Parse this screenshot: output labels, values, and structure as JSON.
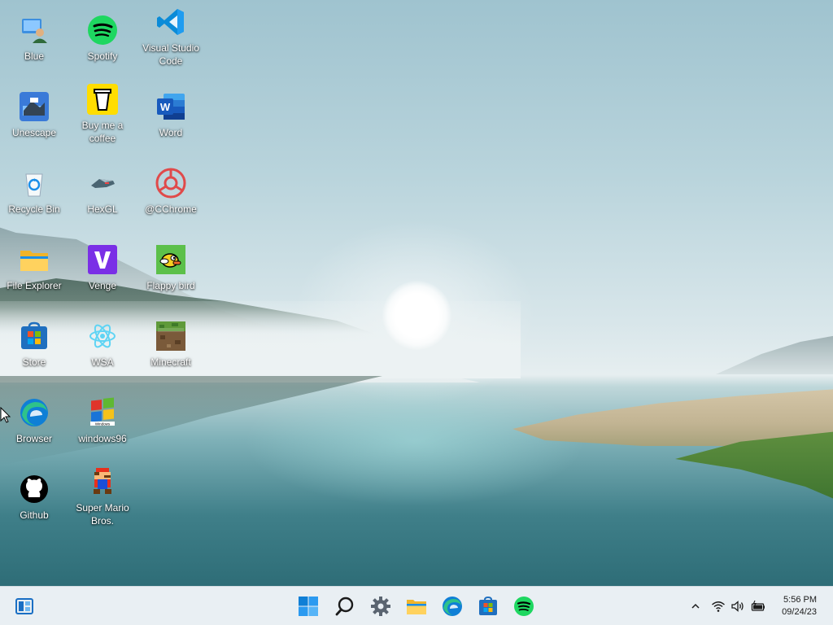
{
  "desktop_icons": [
    {
      "label": "Blue",
      "icon": "blue-user-icon"
    },
    {
      "label": "Spotify",
      "icon": "spotify-icon"
    },
    {
      "label": "Visual Studio Code",
      "icon": "vscode-icon"
    },
    {
      "label": "Unescape",
      "icon": "unescape-game-icon"
    },
    {
      "label": "Buy me a coffee",
      "icon": "coffee-cup-icon"
    },
    {
      "label": "Word",
      "icon": "word-icon"
    },
    {
      "label": "Recycle Bin",
      "icon": "recycle-bin-icon"
    },
    {
      "label": "HexGL",
      "icon": "hexgl-ship-icon"
    },
    {
      "label": "@CChrome",
      "icon": "cchrome-icon"
    },
    {
      "label": "File Explorer",
      "icon": "folder-icon"
    },
    {
      "label": "Venge",
      "icon": "venge-icon"
    },
    {
      "label": "Flappy bird",
      "icon": "flappy-bird-icon"
    },
    {
      "label": "Store",
      "icon": "store-icon"
    },
    {
      "label": "WSA",
      "icon": "wsa-icon"
    },
    {
      "label": "Minecraft",
      "icon": "minecraft-icon"
    },
    {
      "label": "Browser",
      "icon": "edge-icon"
    },
    {
      "label": "windows96",
      "icon": "windows96-icon"
    },
    {
      "label": "Github",
      "icon": "github-icon"
    },
    {
      "label": "Super Mario Bros.",
      "icon": "mario-icon"
    }
  ],
  "taskbar": {
    "left": [
      {
        "icon": "widgets-icon"
      }
    ],
    "center": [
      {
        "icon": "start-windows-icon"
      },
      {
        "icon": "search-icon"
      },
      {
        "icon": "settings-gear-icon"
      },
      {
        "icon": "file-explorer-icon"
      },
      {
        "icon": "edge-icon"
      },
      {
        "icon": "store-icon"
      },
      {
        "icon": "spotify-icon"
      }
    ],
    "tray": [
      {
        "icon": "chevron-up-icon"
      },
      {
        "icon": "wifi-icon"
      },
      {
        "icon": "volume-icon"
      },
      {
        "icon": "battery-icon"
      }
    ],
    "clock": {
      "time": "5:56 PM",
      "date": "09/24/23"
    }
  },
  "colors": {
    "spotify_green": "#1ed760",
    "vscode_blue": "#0a8bd8",
    "word_blue": "#185abd",
    "taskbar_bg": "#e8eef3",
    "windows_blue": "#0f7fd6"
  }
}
